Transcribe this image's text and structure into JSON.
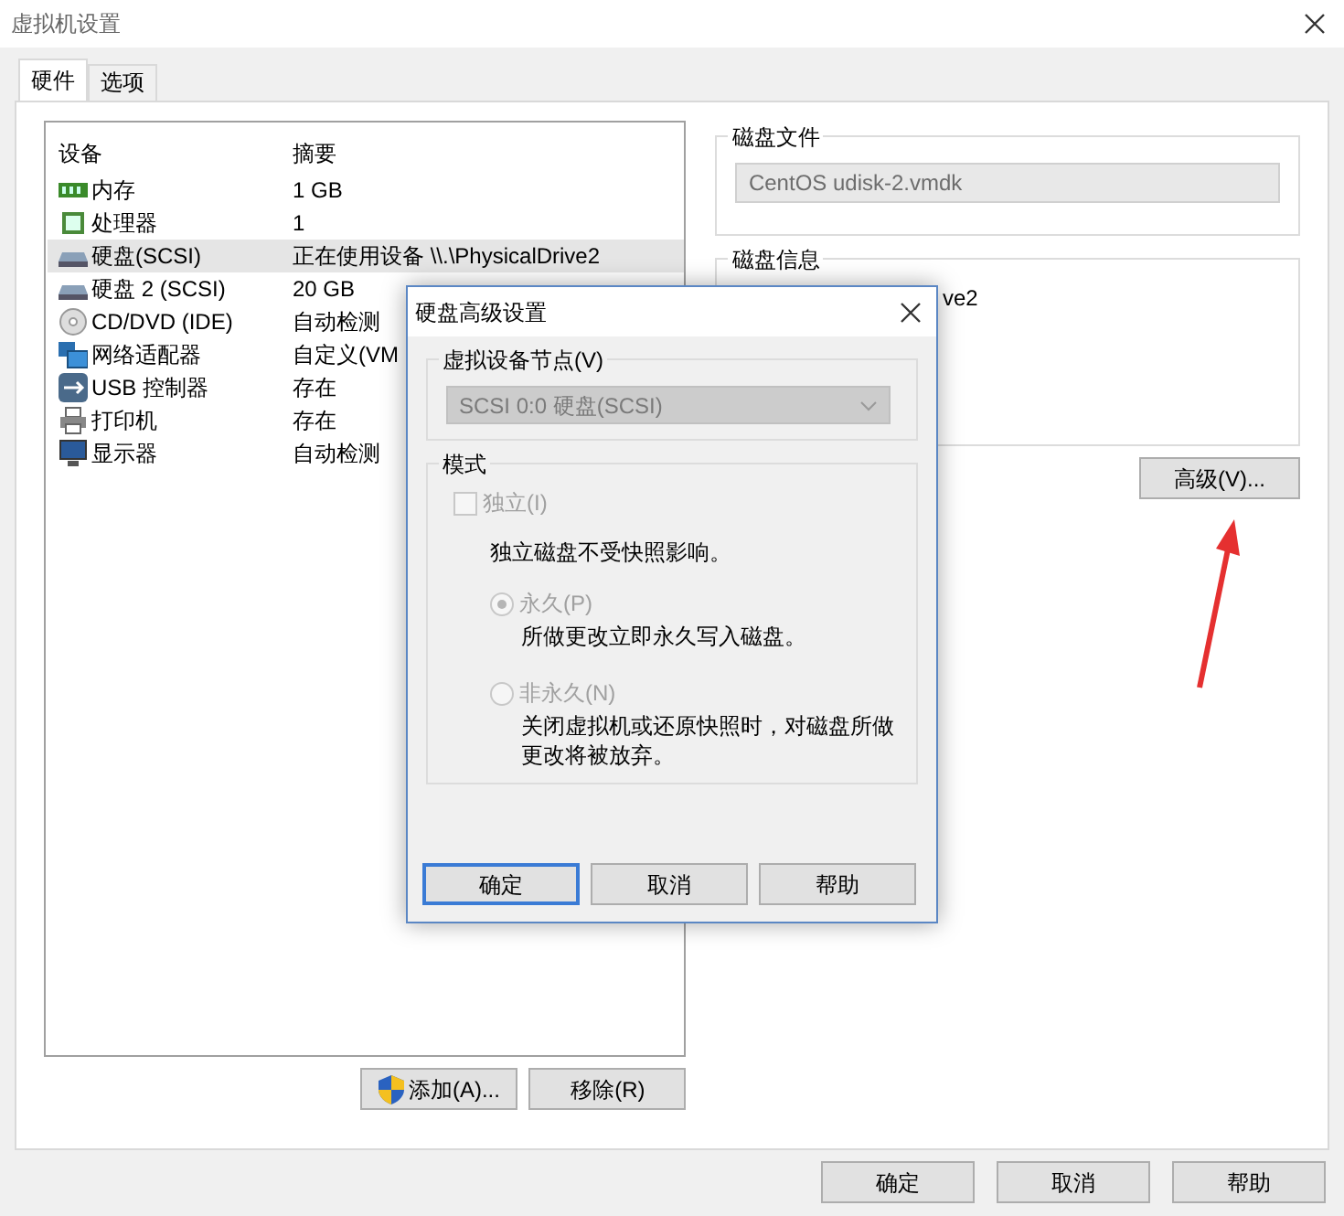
{
  "window": {
    "title": "虚拟机设置"
  },
  "tabs": [
    {
      "label": "硬件",
      "selected": true
    },
    {
      "label": "选项",
      "selected": false
    }
  ],
  "device_list": {
    "columns": [
      "设备",
      "摘要"
    ],
    "rows": [
      {
        "kind": "memory",
        "device": "内存",
        "summary": "1 GB",
        "selected": false
      },
      {
        "kind": "cpu",
        "device": "处理器",
        "summary": "1",
        "selected": false
      },
      {
        "kind": "disk",
        "device": "硬盘(SCSI)",
        "summary": "正在使用设备 \\\\.\\PhysicalDrive2",
        "selected": true
      },
      {
        "kind": "disk",
        "device": "硬盘 2 (SCSI)",
        "summary": "20 GB",
        "selected": false
      },
      {
        "kind": "cdrom",
        "device": "CD/DVD (IDE)",
        "summary": "自动检测",
        "selected": false
      },
      {
        "kind": "network",
        "device": "网络适配器",
        "summary": "自定义(VM",
        "selected": false
      },
      {
        "kind": "usb",
        "device": "USB 控制器",
        "summary": "存在",
        "selected": false
      },
      {
        "kind": "printer",
        "device": "打印机",
        "summary": "存在",
        "selected": false
      },
      {
        "kind": "display",
        "device": "显示器",
        "summary": "自动检测",
        "selected": false
      }
    ]
  },
  "disk_file": {
    "label": "磁盘文件",
    "value": "CentOS udisk-2.vmdk"
  },
  "disk_info": {
    "label": "磁盘信息",
    "text": "ve2"
  },
  "advanced_button": "高级(V)...",
  "list_buttons": [
    {
      "label": "添加(A)...",
      "shield": true
    },
    {
      "label": "移除(R)",
      "shield": false
    }
  ],
  "footer_buttons": [
    "确定",
    "取消",
    "帮助"
  ],
  "dialog": {
    "title": "硬盘高级设置",
    "node_group": {
      "label": "虚拟设备节点(V)",
      "value": "SCSI 0:0   硬盘(SCSI)",
      "disabled": true
    },
    "mode_group": {
      "label": "模式",
      "independent": {
        "label": "独立(I)",
        "checked": false,
        "disabled": true
      },
      "note": "独立磁盘不受快照影响。",
      "options": [
        {
          "label": "永久(P)",
          "note": "所做更改立即永久写入磁盘。",
          "selected": true,
          "disabled": true
        },
        {
          "label": "非永久(N)",
          "note": "关闭虚拟机或还原快照时，对磁盘所做更改将被放弃。",
          "selected": false,
          "disabled": true
        }
      ]
    },
    "buttons": [
      {
        "label": "确定",
        "focused": true
      },
      {
        "label": "取消",
        "focused": false
      },
      {
        "label": "帮助",
        "focused": false
      }
    ]
  }
}
